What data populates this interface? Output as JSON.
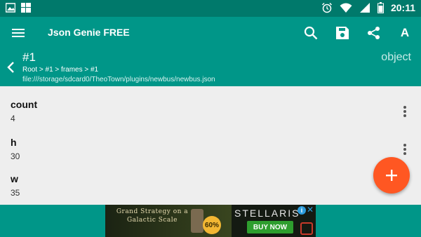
{
  "status_bar": {
    "time": "20:11",
    "left_icons": [
      "image-icon",
      "windows-icon"
    ],
    "right_icons": [
      "alarm-icon",
      "wifi-icon",
      "signal-icon",
      "battery-icon"
    ]
  },
  "toolbar": {
    "title": "Json Genie FREE",
    "actions": [
      "search-icon",
      "save-icon",
      "share-icon",
      "font-icon"
    ],
    "font_label": "A"
  },
  "node": {
    "title": "#1",
    "path": "Root > #1 > frames > #1",
    "file": "file:///storage/sdcard0/TheoTown/plugins/newbus/newbus.json",
    "type": "object"
  },
  "items": [
    {
      "key": "count",
      "value": "4"
    },
    {
      "key": "h",
      "value": "30"
    },
    {
      "key": "w",
      "value": "35"
    }
  ],
  "fab": {
    "icon": "plus-icon",
    "label": "+"
  },
  "ad": {
    "tagline": "Grand Strategy on a Galactic Scale",
    "discount": "60%",
    "brand": "STELLARIS",
    "cta": "BUY NOW",
    "info": "i",
    "close": "✕"
  },
  "colors": {
    "primary": "#009688",
    "primary_dark": "#00796b",
    "accent": "#ff5722",
    "background": "#eeeeee"
  }
}
